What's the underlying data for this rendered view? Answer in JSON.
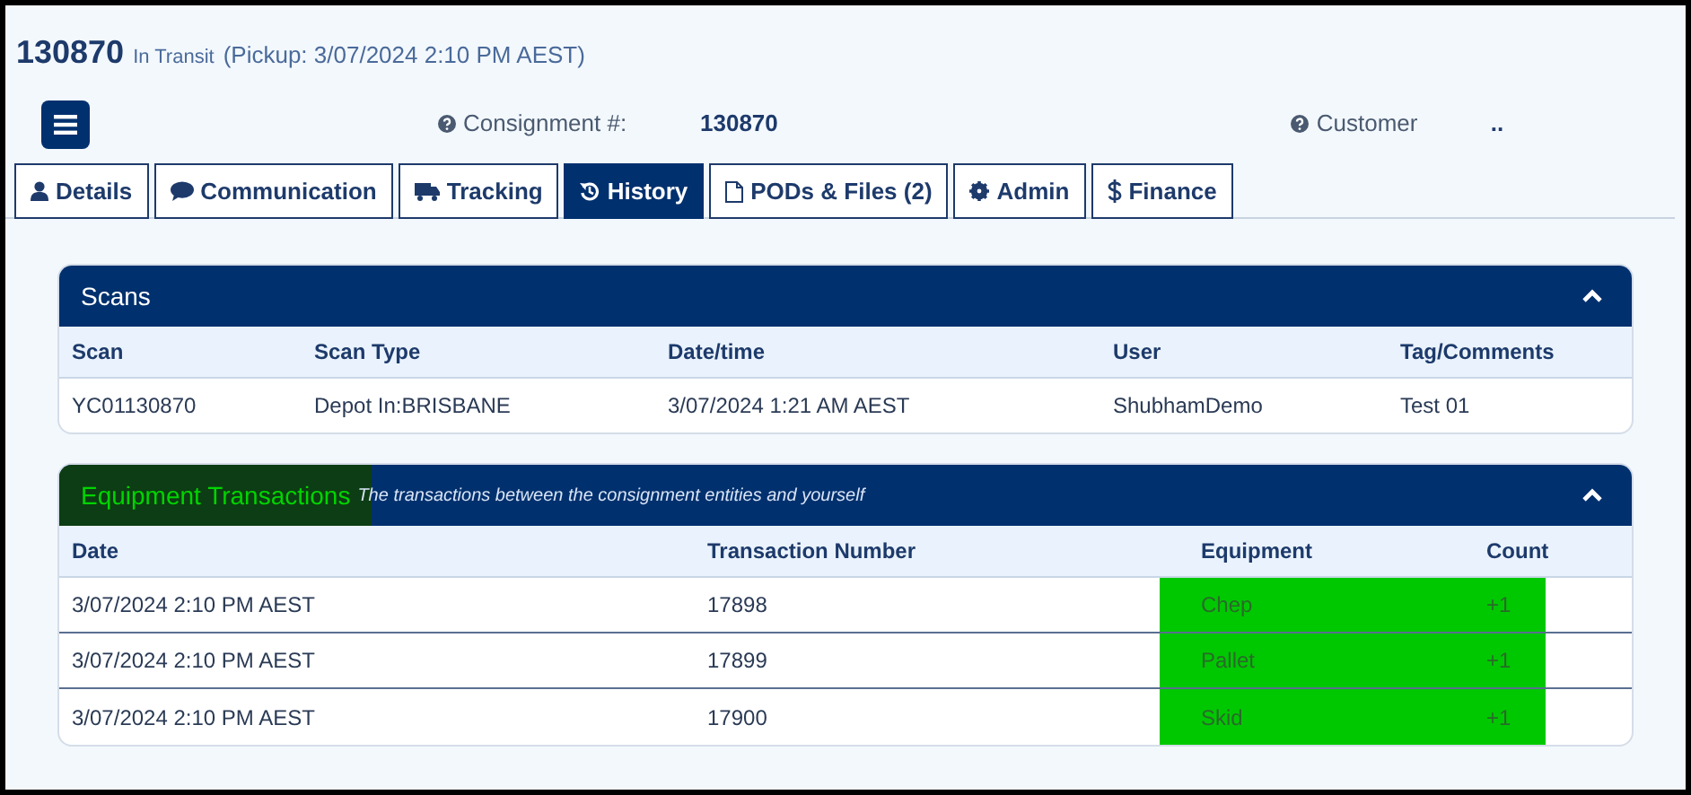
{
  "header": {
    "number": "130870",
    "status": "In Transit",
    "pickup": "(Pickup: 3/07/2024 2:10 PM AEST)"
  },
  "info": [
    {
      "label": "Consignment #:",
      "value": "130870"
    },
    {
      "label": "Customer",
      "value": ".."
    }
  ],
  "tabs": [
    {
      "label": "Details",
      "kind": "user",
      "selected": false
    },
    {
      "label": "Communication",
      "kind": "comment",
      "selected": false
    },
    {
      "label": "Tracking",
      "kind": "truck",
      "selected": false
    },
    {
      "label": "History",
      "kind": "history",
      "selected": true
    },
    {
      "label": "PODs & Files (2)",
      "kind": "file",
      "selected": false
    },
    {
      "label": "Admin",
      "kind": "gear",
      "selected": false
    },
    {
      "label": "Finance",
      "kind": "dollar",
      "selected": false
    }
  ],
  "scans": {
    "title": "Scans",
    "expanded": true,
    "columns": [
      "Scan",
      "Scan Type",
      "Date/time",
      "User",
      "Tag/Comments"
    ],
    "rows": [
      [
        "YC01130870",
        "Depot In:BRISBANE",
        "3/07/2024 1:21 AM AEST",
        "ShubhamDemo",
        "Test 01"
      ]
    ]
  },
  "equipment": {
    "title": "Equipment Transactions",
    "title_highlighted": true,
    "subtitle": "The transactions between the consignment entities and yourself",
    "expanded": true,
    "columns": [
      "Date",
      "Transaction Number",
      "Equipment",
      "Count"
    ],
    "rows": [
      {
        "cells": [
          "3/07/2024 2:10 PM AEST",
          "17898",
          "Chep",
          "+1"
        ],
        "highlighted": true
      },
      {
        "cells": [
          "3/07/2024 2:10 PM AEST",
          "17899",
          "Pallet",
          "+1"
        ],
        "highlighted": true
      },
      {
        "cells": [
          "3/07/2024 2:10 PM AEST",
          "17900",
          "Skid",
          "+1"
        ],
        "highlighted": true
      }
    ]
  }
}
